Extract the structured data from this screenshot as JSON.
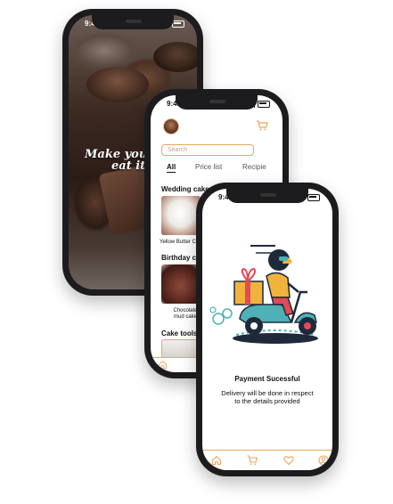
{
  "phone1": {
    "time": "9:41",
    "tagline_line1": "Make your c",
    "tagline_line2": "eat it t"
  },
  "phone2": {
    "time": "9:41",
    "search_placeholder": "Search",
    "tabs": [
      "All",
      "Price list",
      "Recipie"
    ],
    "section_wedding": "Wedding cakes",
    "wedding_item": "Yellow Butter C",
    "section_birthday": "Birthday ca",
    "birthday_item_line1": "Chocolate",
    "birthday_item_line2": "mud cake",
    "section_tools": "Cake tools"
  },
  "phone3": {
    "time": "9:41",
    "title": "Payment Sucessful",
    "message_line1": "Delivery will be done in respect",
    "message_line2": "to the details provided",
    "nav_icons": [
      "home-icon",
      "cart-icon",
      "heart-icon",
      "profile-icon"
    ]
  },
  "colors": {
    "accent": "#E8A85F",
    "scooter": "#4FB0B8",
    "box": "#F2B33D",
    "ribbon": "#E24B55"
  }
}
